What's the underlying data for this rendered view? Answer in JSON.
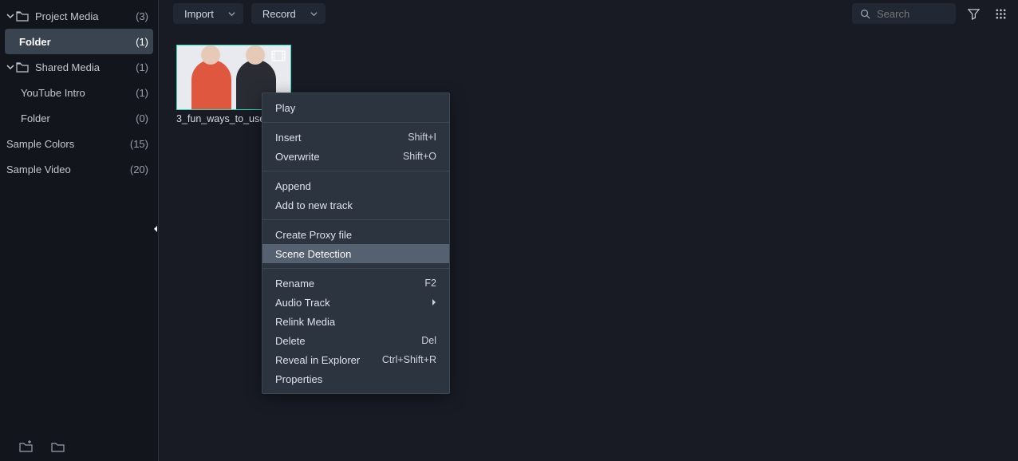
{
  "sidebar": {
    "items": [
      {
        "label": "Project Media",
        "count": "(3)",
        "hasChevron": true,
        "hasFolderIcon": true
      },
      {
        "label": "Folder",
        "count": "(1)",
        "selected": true
      },
      {
        "label": "Shared Media",
        "count": "(1)",
        "hasChevron": true,
        "hasFolderIcon": true
      },
      {
        "label": "YouTube Intro",
        "count": "(1)"
      },
      {
        "label": "Folder",
        "count": "(0)"
      },
      {
        "label": "Sample Colors",
        "count": "(15)"
      },
      {
        "label": "Sample Video",
        "count": "(20)"
      }
    ]
  },
  "toolbar": {
    "import_label": "Import",
    "record_label": "Record",
    "search_placeholder": "Search"
  },
  "thumbnail": {
    "filename": "3_fun_ways_to_use_"
  },
  "context_menu": {
    "items": [
      {
        "label": "Play"
      },
      {
        "sep": true
      },
      {
        "label": "Insert",
        "shortcut": "Shift+I"
      },
      {
        "label": "Overwrite",
        "shortcut": "Shift+O"
      },
      {
        "sep": true
      },
      {
        "label": "Append"
      },
      {
        "label": "Add to new track"
      },
      {
        "sep": true
      },
      {
        "label": "Create Proxy file"
      },
      {
        "label": "Scene Detection",
        "hover": true
      },
      {
        "sep": true
      },
      {
        "label": "Rename",
        "shortcut": "F2"
      },
      {
        "label": "Audio Track",
        "submenu": true
      },
      {
        "label": "Relink Media"
      },
      {
        "label": "Delete",
        "shortcut": "Del"
      },
      {
        "label": "Reveal in Explorer",
        "shortcut": "Ctrl+Shift+R"
      },
      {
        "label": "Properties"
      }
    ]
  }
}
